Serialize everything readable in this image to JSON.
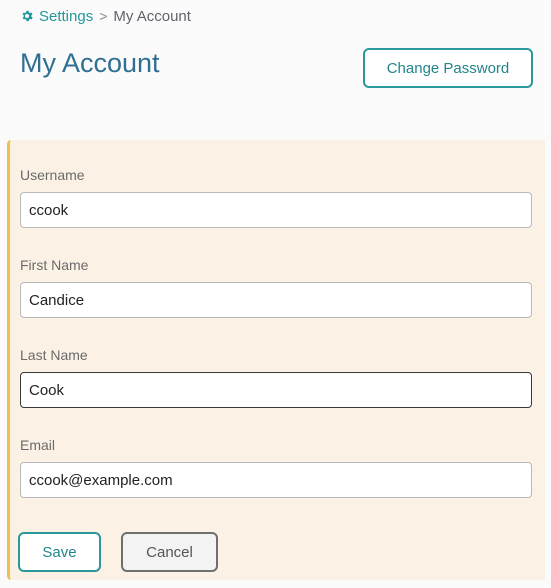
{
  "breadcrumb": {
    "root_label": "Settings",
    "current_label": "My Account",
    "separator": ">"
  },
  "header": {
    "title": "My Account",
    "change_password_label": "Change Password"
  },
  "form": {
    "username": {
      "label": "Username",
      "value": "ccook"
    },
    "first_name": {
      "label": "First Name",
      "value": "Candice"
    },
    "last_name": {
      "label": "Last Name",
      "value": "Cook"
    },
    "email": {
      "label": "Email",
      "value": "ccook@example.com"
    }
  },
  "actions": {
    "save_label": "Save",
    "cancel_label": "Cancel"
  },
  "colors": {
    "accent": "#2a989c",
    "title": "#2f6f92",
    "panel_bg": "#fbf2e5",
    "panel_border": "#f0c04e"
  },
  "icons": {
    "settings": "gear-icon"
  }
}
